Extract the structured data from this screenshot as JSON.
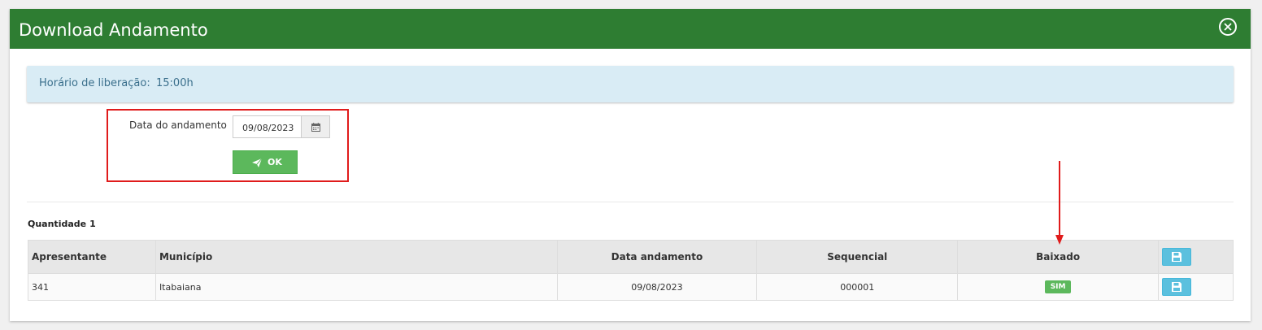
{
  "modal": {
    "title": "Download Andamento"
  },
  "info": {
    "label": "Horário de liberação:",
    "value": "15:00h"
  },
  "form": {
    "date_label": "Data do andamento",
    "date_value": "09/08/2023",
    "ok_label": "OK"
  },
  "summary": {
    "quantity_label": "Quantidade",
    "quantity_value": "1"
  },
  "table": {
    "headers": {
      "apresentante": "Apresentante",
      "municipio": "Município",
      "data_andamento": "Data andamento",
      "sequencial": "Sequencial",
      "baixado": "Baixado"
    },
    "rows": [
      {
        "apresentante": "341",
        "municipio": "Itabaiana",
        "data_andamento": "09/08/2023",
        "sequencial": "000001",
        "baixado": "SIM"
      }
    ]
  },
  "icons": {
    "close": "close-icon",
    "calendar": "calendar-icon",
    "send": "paper-plane-icon",
    "save": "floppy-disk-icon"
  },
  "colors": {
    "header_bg": "#2e7d32",
    "info_bg": "#d9ecf5",
    "success": "#5cb85c",
    "save_button": "#5bc0de",
    "annotation": "#e01b1b"
  }
}
